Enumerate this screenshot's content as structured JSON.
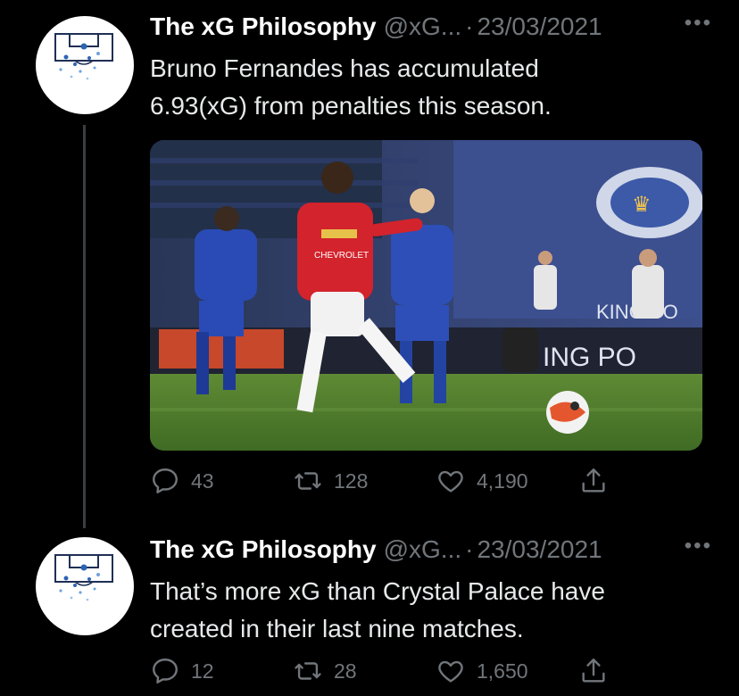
{
  "tweets": [
    {
      "display_name": "The xG Philosophy",
      "handle": "@xG...",
      "separator": "·",
      "date": "23/03/2021",
      "more": "•••",
      "text_lines": [
        "Bruno Fernandes has accumulated",
        "6.93(xG) from penalties this season."
      ],
      "stats": {
        "replies": "43",
        "retweets": "128",
        "likes": "4,190"
      },
      "media": {
        "kind": "photo",
        "shirt_text": "CHEVROLET",
        "board_text": "KING POW",
        "board_text2": "KING PO",
        "banner_text": "ING PO"
      }
    },
    {
      "display_name": "The xG Philosophy",
      "handle": "@xG...",
      "separator": "·",
      "date": "23/03/2021",
      "more": "•••",
      "text_lines": [
        "That’s more xG than Crystal Palace have",
        "created in their last nine matches."
      ],
      "stats": {
        "replies": "12",
        "retweets": "28",
        "likes": "1,650"
      }
    }
  ],
  "colors": {
    "background": "#000000",
    "muted": "#71767b",
    "text": "#e7e9ea"
  },
  "icons": [
    "reply-icon",
    "retweet-icon",
    "like-icon",
    "share-icon",
    "pitch-logo-icon"
  ]
}
